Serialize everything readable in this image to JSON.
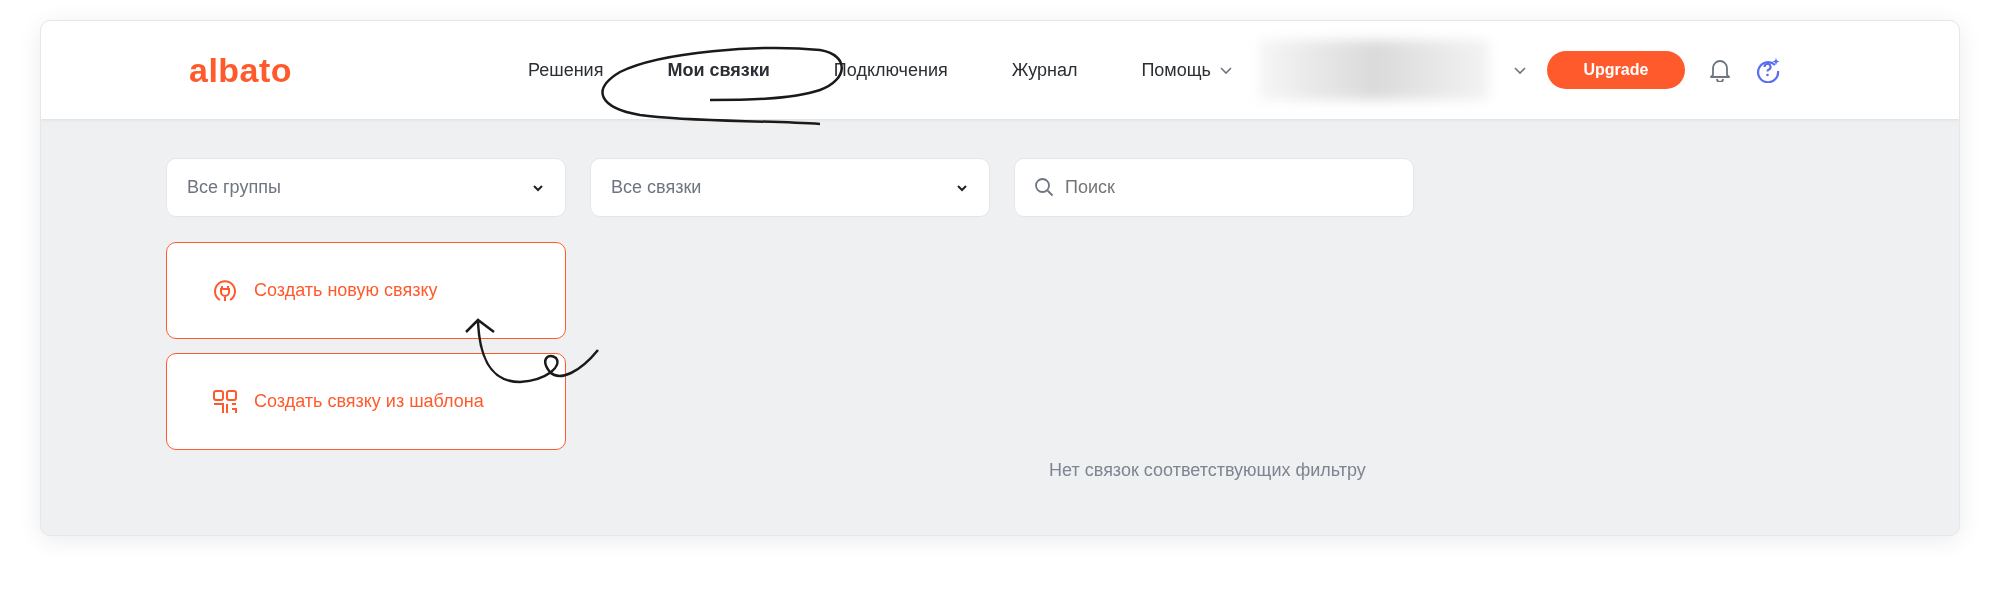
{
  "header": {
    "logo": "albato",
    "nav": [
      {
        "label": "Решения",
        "selected": false,
        "dropdown": false
      },
      {
        "label": "Мои связки",
        "selected": true,
        "dropdown": false
      },
      {
        "label": "Подключения",
        "selected": false,
        "dropdown": false
      },
      {
        "label": "Журнал",
        "selected": false,
        "dropdown": false
      },
      {
        "label": "Помощь",
        "selected": false,
        "dropdown": true
      }
    ],
    "upgrade_button": "Upgrade"
  },
  "filters": [
    {
      "kind": "select",
      "value": "Все группы"
    },
    {
      "kind": "select",
      "value": "Все связки"
    },
    {
      "kind": "search",
      "placeholder": "Поиск"
    }
  ],
  "actions": [
    {
      "kind": "new",
      "label": "Создать новую связку"
    },
    {
      "kind": "template",
      "label": "Создать связку из шаблона"
    }
  ],
  "empty_message": "Нет связок соответствующих фильтру"
}
